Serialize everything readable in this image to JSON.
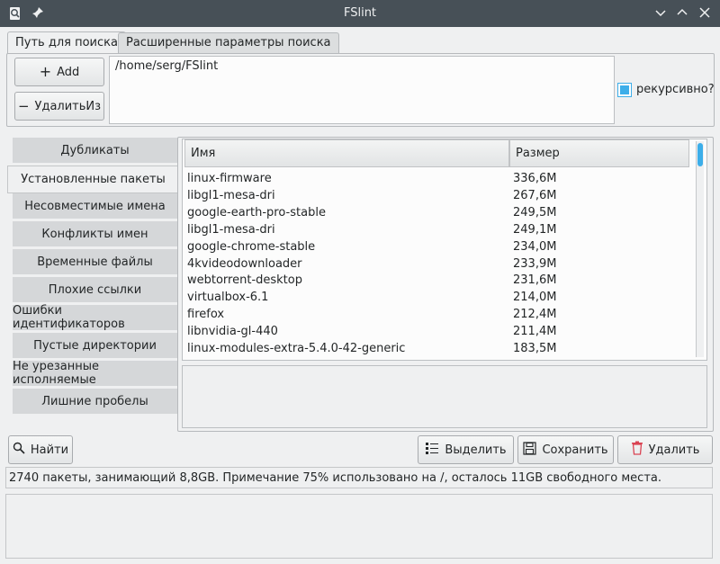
{
  "window": {
    "title": "FSlint"
  },
  "tabs": [
    {
      "label": "Путь для поиска"
    },
    {
      "label": "Расширенные параметры поиска"
    }
  ],
  "search_path": {
    "add_label": "Add",
    "remove_label": "УдалитьИз",
    "paths": [
      "/home/serg/FSlint"
    ],
    "recursive_label": "рекурсивно?",
    "recursive_checked": true
  },
  "sidebar": {
    "items": [
      {
        "label": "Дубликаты"
      },
      {
        "label": "Установленные пакеты"
      },
      {
        "label": "Несовместимые имена"
      },
      {
        "label": "Конфликты имен"
      },
      {
        "label": "Временные файлы"
      },
      {
        "label": "Плохие ссылки"
      },
      {
        "label": "Ошибки идентификаторов"
      },
      {
        "label": "Пустые директории"
      },
      {
        "label": "Не урезанные исполняемые"
      },
      {
        "label": "Лишние пробелы"
      }
    ],
    "active_index": 1
  },
  "table": {
    "columns": [
      "Имя",
      "Размер"
    ],
    "rows": [
      [
        "linux-firmware",
        "336,6M"
      ],
      [
        "libgl1-mesa-dri",
        "267,6M"
      ],
      [
        "google-earth-pro-stable",
        "249,5M"
      ],
      [
        "libgl1-mesa-dri",
        "249,1M"
      ],
      [
        "google-chrome-stable",
        "234,0M"
      ],
      [
        "4kvideodownloader",
        "233,9M"
      ],
      [
        "webtorrent-desktop",
        "231,6M"
      ],
      [
        "virtualbox-6.1",
        "214,0M"
      ],
      [
        "firefox",
        "212,4M"
      ],
      [
        "libnvidia-gl-440",
        "211,4M"
      ],
      [
        "linux-modules-extra-5.4.0-42-generic",
        "183,5M"
      ]
    ]
  },
  "actions": {
    "find_label": "Найти",
    "select_label": "Выделить",
    "save_label": "Сохранить",
    "delete_label": "Удалить"
  },
  "status": {
    "text": "2740 пакеты, занимающий 8,8GB. Примечание 75% использовано на /, осталось 11GB свободного места."
  },
  "colors": {
    "titlebar": "#475057",
    "accent": "#3daee9",
    "delete_icon": "#da4453"
  }
}
